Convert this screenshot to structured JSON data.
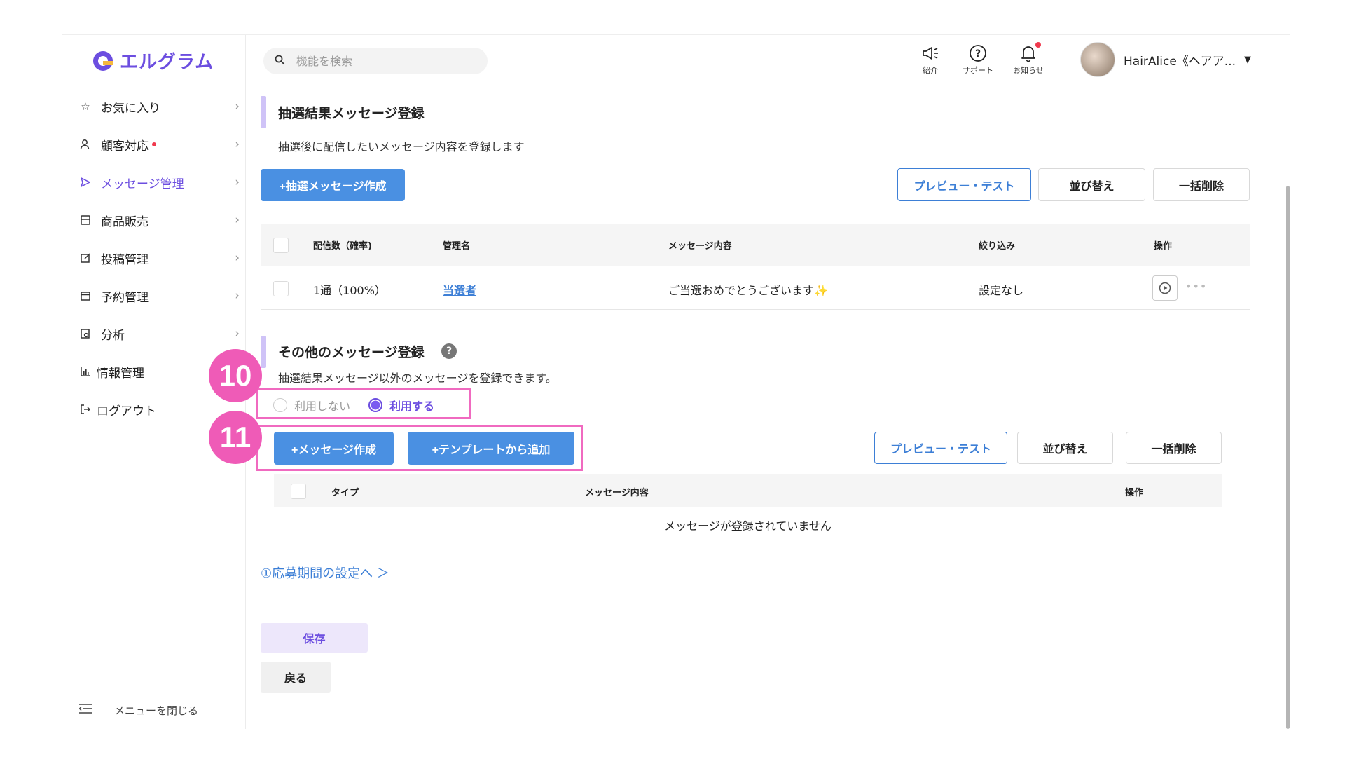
{
  "app": {
    "logo_text": "エルグラム",
    "brand_color": "#6c4ee0"
  },
  "search": {
    "placeholder": "機能を検索"
  },
  "header": {
    "announce_label": "紹介",
    "support_label": "サポート",
    "notice_label": "お知らせ",
    "user_name": "HairAlice《ヘアア...",
    "caret": "▼"
  },
  "sidebar": {
    "items": [
      {
        "label": "お気に入り",
        "icon": "star-icon"
      },
      {
        "label": "顧客対応",
        "icon": "person-icon"
      },
      {
        "label": "メッセージ管理",
        "icon": "send-icon"
      },
      {
        "label": "商品販売",
        "icon": "shop-icon"
      },
      {
        "label": "投稿管理",
        "icon": "edit-icon"
      },
      {
        "label": "予約管理",
        "icon": "calendar-icon"
      },
      {
        "label": "分析",
        "icon": "analysis-icon"
      },
      {
        "label": "情報管理",
        "icon": "chart-icon"
      },
      {
        "label": "ログアウト",
        "icon": "logout-icon"
      }
    ],
    "close_menu": "メニューを閉じる"
  },
  "lottery": {
    "title": "抽選結果メッセージ登録",
    "desc": "抽選後に配信したいメッセージ内容を登録します",
    "create_button": "+抽選メッセージ作成",
    "preview_button": "プレビュー・テスト",
    "sort_button": "並び替え",
    "bulk_delete_button": "一括削除",
    "table": {
      "headers": [
        "配信数（確率)",
        "管理名",
        "メッセージ内容",
        "絞り込み",
        "操作"
      ],
      "rows": [
        {
          "count": "1通（100%）",
          "name": "当選者",
          "message": "ご当選おめでとうございます✨",
          "filter": "設定なし"
        }
      ]
    }
  },
  "other": {
    "title": "その他のメッセージ登録",
    "help": "?",
    "desc": "抽選結果メッセージ以外のメッセージを登録できます。",
    "radio_off": "利用しない",
    "radio_on": "利用する",
    "create_button": "+メッセージ作成",
    "template_button": "+テンプレートから追加",
    "preview_button": "プレビュー・テスト",
    "sort_button": "並び替え",
    "bulk_delete_button": "一括削除",
    "table": {
      "headers": [
        "タイプ",
        "メッセージ内容",
        "操作"
      ],
      "empty": "メッセージが登録されていません"
    }
  },
  "annotations": {
    "badge_10": "10",
    "badge_11": "11"
  },
  "footer": {
    "period_link": "①応募期間の設定へ ＞",
    "save_button": "保存",
    "back_button": "戻る"
  }
}
